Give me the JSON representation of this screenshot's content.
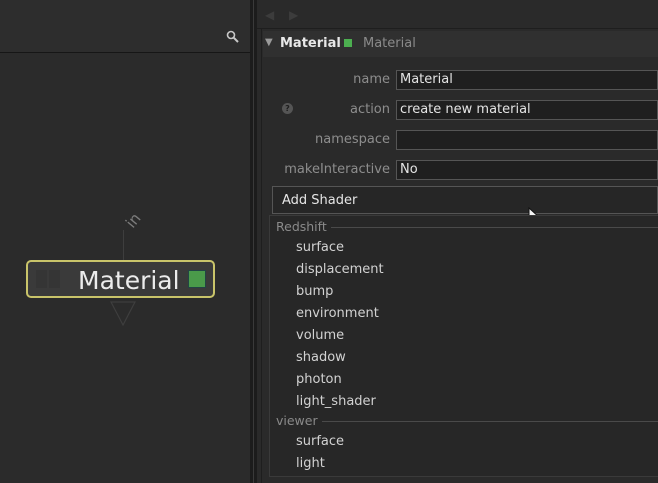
{
  "node_graph": {
    "search_icon": "magnifier-icon",
    "node": {
      "label": "Material",
      "swatch_color": "#4a9a4a",
      "border_color": "#c9c46a"
    },
    "input_label": "in"
  },
  "parameters": {
    "header": {
      "name": "Material",
      "type": "Material",
      "indicator_color": "#4caf50"
    },
    "fields": {
      "name": {
        "label": "name",
        "value": "Material"
      },
      "action": {
        "label": "action",
        "value": "create new material"
      },
      "namespace": {
        "label": "namespace",
        "value": ""
      },
      "make_interactive": {
        "label": "makeInteractive",
        "value": "No"
      }
    },
    "help_icon_glyph": "?",
    "add_shader_label": "Add Shader",
    "menu": {
      "sections": [
        {
          "title": "Redshift",
          "items": [
            "surface",
            "displacement",
            "bump",
            "environment",
            "volume",
            "shadow",
            "photon",
            "light_shader"
          ]
        },
        {
          "title": "viewer",
          "items": [
            "surface",
            "light"
          ]
        }
      ]
    }
  }
}
